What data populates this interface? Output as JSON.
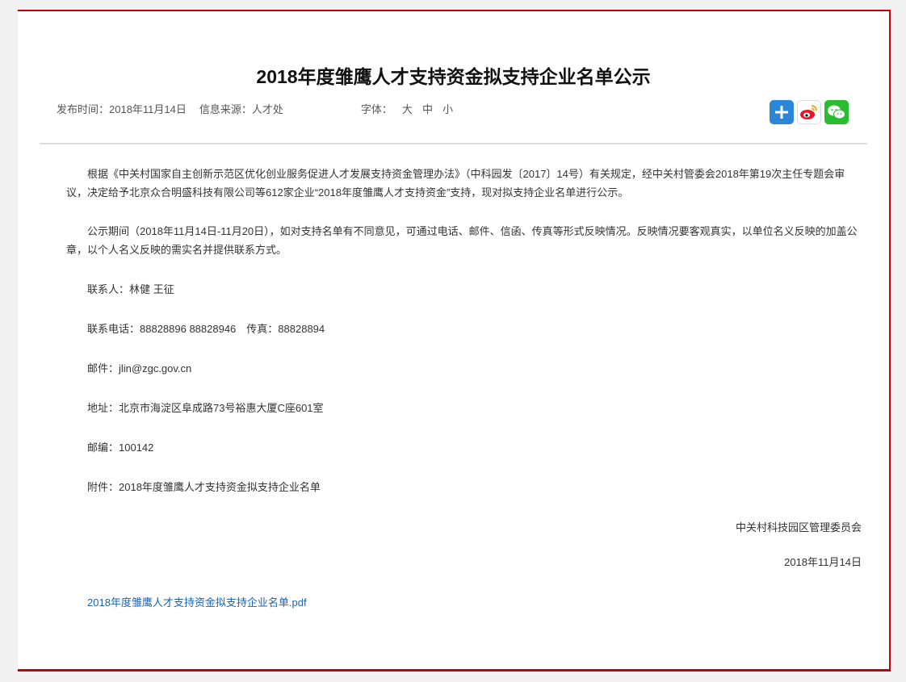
{
  "article": {
    "title": "2018年度雏鹰人才支持资金拟支持企业名单公示",
    "meta": {
      "publish_time": "发布时间：2018年11月14日",
      "source": "信息来源：人才处",
      "font_label": "字体：",
      "font_large": "大",
      "font_medium": "中",
      "font_small": "小"
    },
    "share_icons": [
      "add-share-icon",
      "weibo-icon",
      "wechat-icon"
    ],
    "paragraphs": [
      "根据《中关村国家自主创新示范区优化创业服务促进人才发展支持资金管理办法》（中科园发〔2017〕14号）有关规定，经中关村管委会2018年第19次主任专题会审议，决定给予北京众合明盛科技有限公司等612家企业“2018年度雏鹰人才支持资金”支持，现对拟支持企业名单进行公示。",
      "公示期间（2018年11月14日-11月20日），如对支持名单有不同意见，可通过电话、邮件、信函、传真等形式反映情况。反映情况要客观真实，以单位名义反映的加盖公章，以个人名义反映的需实名并提供联系方式。",
      "联系人：林健 王征",
      "联系电话：88828896 88828946　传真：88828894",
      "邮件：jlin@zgc.gov.cn",
      "地址：北京市海淀区阜成路73号裕惠大厦C座601室",
      "邮编：100142",
      "附件：2018年度雏鹰人才支持资金拟支持企业名单"
    ],
    "signature": "中关村科技园区管理委员会",
    "date": "2018年11月14日",
    "attachment_link": "2018年度雏鹰人才支持资金拟支持企业名单.pdf"
  },
  "colors": {
    "accent_border": "#c7000b",
    "link": "#1a63b5"
  }
}
